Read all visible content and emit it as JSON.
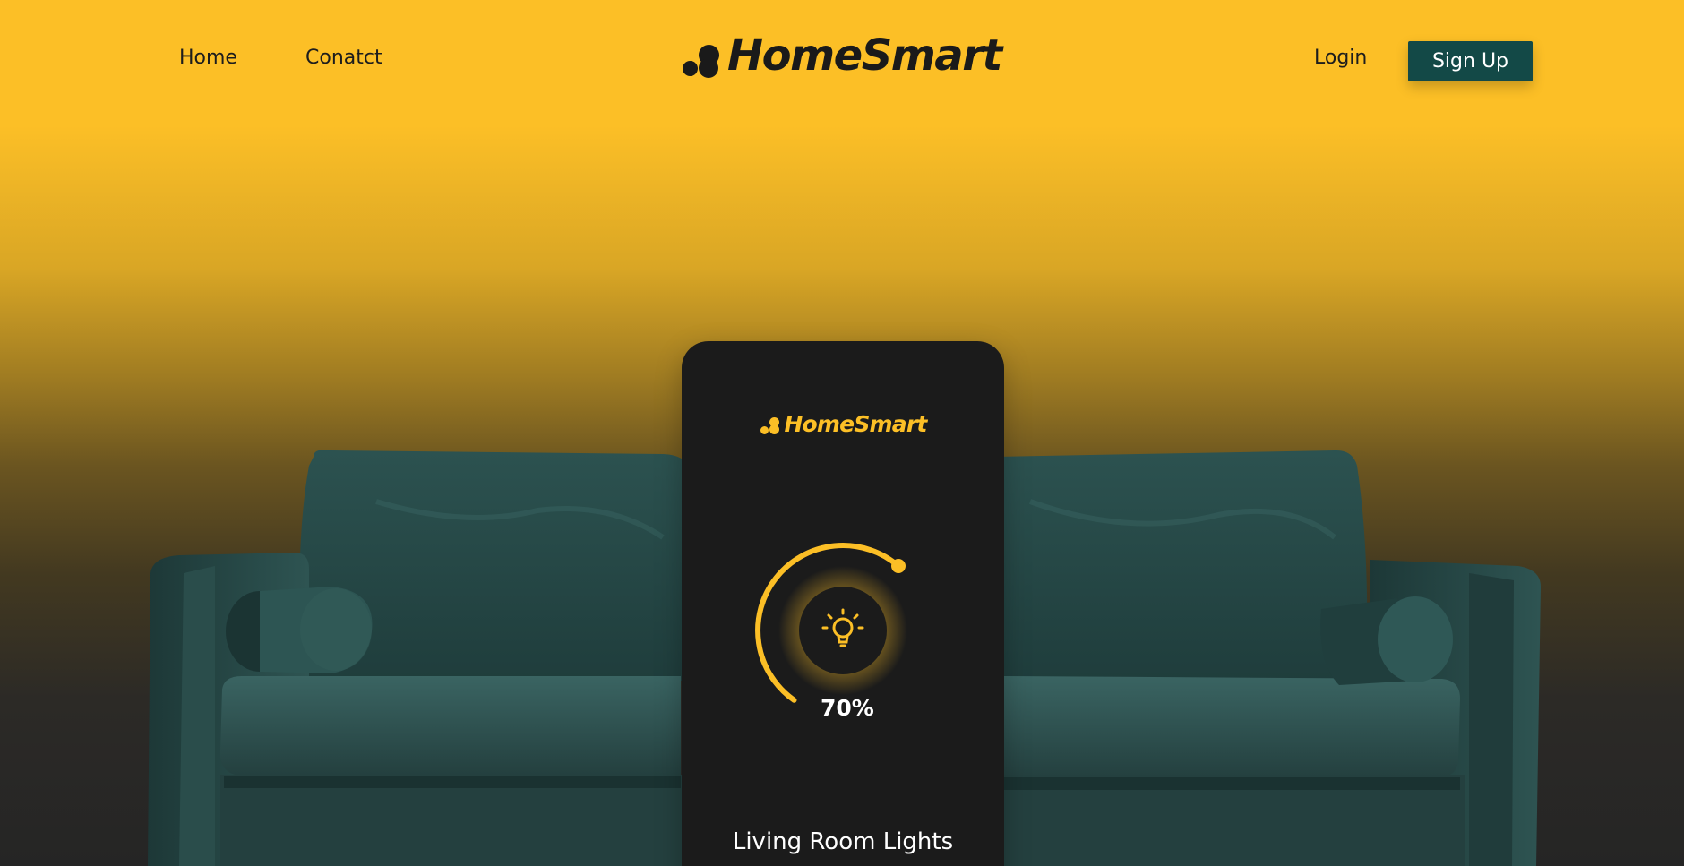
{
  "nav": {
    "home_label": "Home",
    "contact_label": "Conatct",
    "login_label": "Login",
    "signup_label": "Sign Up"
  },
  "brand": {
    "name": "HomeSmart"
  },
  "phone": {
    "brand_name": "HomeSmart",
    "device_icon": "lightbulb-icon",
    "brightness_percent": 70,
    "brightness_label": "70%",
    "device_name": "Living Room Lights"
  },
  "colors": {
    "accent_yellow": "#fcbf26",
    "button_green": "#134947",
    "phone_dark": "#1b1b1b",
    "sofa_teal": "#2f5654"
  }
}
